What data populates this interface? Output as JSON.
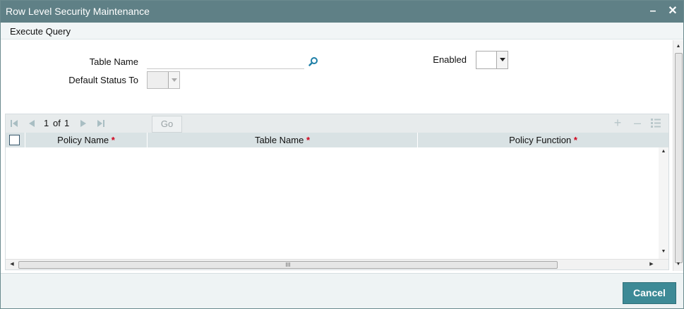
{
  "window": {
    "title": "Row Level Security Maintenance",
    "minimize_glyph": "–",
    "close_glyph": "✕"
  },
  "menu": {
    "execute_query": "Execute Query"
  },
  "form": {
    "table_name_label": "Table Name",
    "table_name_value": "",
    "default_status_label": "Default Status To",
    "default_status_value": "",
    "enabled_label": "Enabled",
    "enabled_value": ""
  },
  "grid": {
    "pager": {
      "current": "1",
      "of_label": "of",
      "total": "1"
    },
    "go_label": "Go",
    "toolbar_icons": [
      "add-row-icon",
      "delete-row-icon",
      "single-view-icon"
    ],
    "columns": [
      {
        "label": "Policy Name",
        "required": "*"
      },
      {
        "label": "Table Name",
        "required": "*"
      },
      {
        "label": "Policy Function",
        "required": "*"
      }
    ],
    "rows": [],
    "hscroll_grip": "III"
  },
  "footer": {
    "cancel_label": "Cancel"
  },
  "colors": {
    "titlebar": "#5f8086",
    "header": "#d9e2e4",
    "cancel": "#3d8a96",
    "required": "#d0021b"
  }
}
